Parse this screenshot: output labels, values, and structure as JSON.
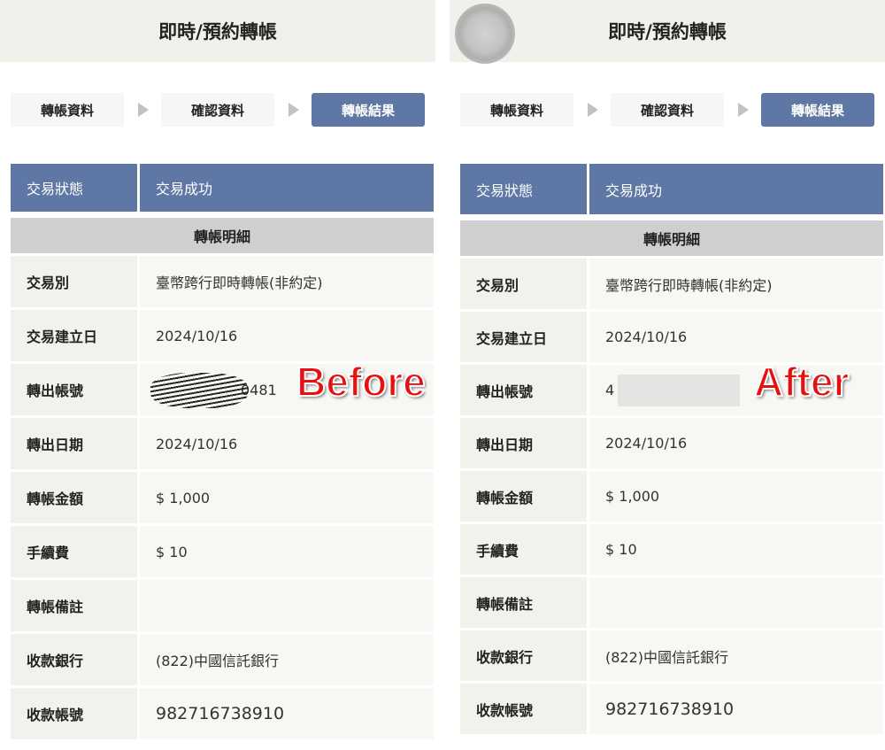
{
  "panels": [
    {
      "title": "即時/預約轉帳",
      "steps": [
        "轉帳資料",
        "確認資料",
        "轉帳結果"
      ],
      "status": {
        "label": "交易狀態",
        "value": "交易成功"
      },
      "section": "轉帳明細",
      "rows": [
        {
          "label": "交易別",
          "value": "臺幣跨行即時轉帳(非約定)"
        },
        {
          "label": "交易建立日",
          "value": "2024/10/16"
        },
        {
          "label": "轉出帳號",
          "value": "0481",
          "masked": "scribble"
        },
        {
          "label": "轉出日期",
          "value": "2024/10/16"
        },
        {
          "label": "轉帳金額",
          "value": "$ 1,000"
        },
        {
          "label": "手續費",
          "value": "$ 10"
        },
        {
          "label": "轉帳備註",
          "value": ""
        },
        {
          "label": "收款銀行",
          "value": "(822)中國信託銀行"
        },
        {
          "label": "收款帳號",
          "value": "982716738910"
        }
      ],
      "tag": "Before"
    },
    {
      "title": "即時/預約轉帳",
      "steps": [
        "轉帳資料",
        "確認資料",
        "轉帳結果"
      ],
      "status": {
        "label": "交易狀態",
        "value": "交易成功"
      },
      "section": "轉帳明細",
      "rows": [
        {
          "label": "交易別",
          "value": "臺幣跨行即時轉帳(非約定)"
        },
        {
          "label": "交易建立日",
          "value": "2024/10/16"
        },
        {
          "label": "轉出帳號",
          "value": "4",
          "masked": "blur"
        },
        {
          "label": "轉出日期",
          "value": "2024/10/16"
        },
        {
          "label": "轉帳金額",
          "value": "$ 1,000"
        },
        {
          "label": "手續費",
          "value": "$ 10"
        },
        {
          "label": "轉帳備註",
          "value": ""
        },
        {
          "label": "收款銀行",
          "value": "(822)中國信託銀行"
        },
        {
          "label": "收款帳號",
          "value": "982716738910"
        }
      ],
      "tag": "After"
    }
  ],
  "colors": {
    "accent": "#5e77a4",
    "section": "#cfcfcf",
    "tag": "#e8100f"
  }
}
